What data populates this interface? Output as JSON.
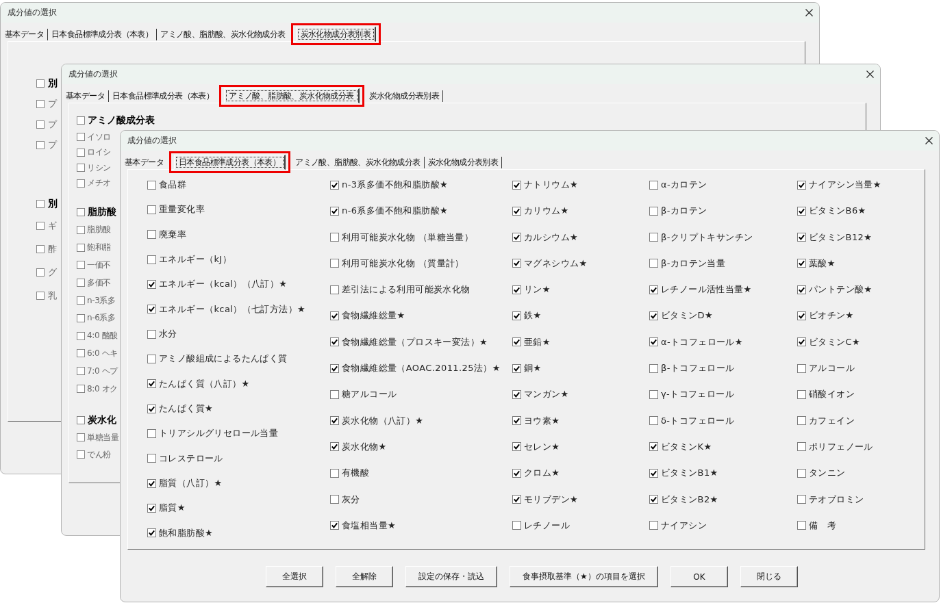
{
  "windows": [
    {
      "title": "成分値の選択",
      "tabs": [
        {
          "label": "基本データ",
          "selected": false,
          "highlighted": false
        },
        {
          "label": "日本食品標準成分表（本表）",
          "selected": false,
          "highlighted": false
        },
        {
          "label": "アミノ酸、脂肪酸、炭水化物成分表",
          "selected": false,
          "highlighted": false
        },
        {
          "label": "炭水化物成分表別表",
          "selected": true,
          "highlighted": true
        }
      ],
      "content": {
        "kind": "groups",
        "groups": [
          {
            "label": "別",
            "checked": false,
            "items": [
              {
                "label": "プ",
                "checked": false
              },
              {
                "label": "プ",
                "checked": false
              },
              {
                "label": "プ",
                "checked": false
              }
            ]
          },
          {
            "label": "別",
            "checked": false,
            "items": [
              {
                "label": "ギ",
                "checked": false
              },
              {
                "label": "酢",
                "checked": false
              },
              {
                "label": "グ",
                "checked": false
              },
              {
                "label": "乳",
                "checked": false
              }
            ]
          }
        ]
      }
    },
    {
      "title": "成分値の選択",
      "tabs": [
        {
          "label": "基本データ",
          "selected": false,
          "highlighted": false
        },
        {
          "label": "日本食品標準成分表（本表）",
          "selected": false,
          "highlighted": false
        },
        {
          "label": "アミノ酸、脂肪酸、炭水化物成分表",
          "selected": true,
          "highlighted": true
        },
        {
          "label": "炭水化物成分表別表",
          "selected": false,
          "highlighted": false
        }
      ],
      "content": {
        "kind": "groups",
        "groups": [
          {
            "label": "アミノ酸成分表",
            "checked": false,
            "items": [
              {
                "label": "イソロ",
                "checked": false
              },
              {
                "label": "ロイシ",
                "checked": false
              },
              {
                "label": "リシン",
                "checked": false
              },
              {
                "label": "メチオ",
                "checked": false
              }
            ]
          },
          {
            "label": "脂肪酸",
            "checked": false,
            "items": [
              {
                "label": "脂肪酸",
                "checked": false
              },
              {
                "label": "飽和脂",
                "checked": false
              },
              {
                "label": "一価不",
                "checked": false
              },
              {
                "label": "多価不",
                "checked": false
              },
              {
                "label": "n-3系多",
                "checked": false
              },
              {
                "label": "n-6系多",
                "checked": false
              },
              {
                "label": "4:0 酪酸",
                "checked": false
              },
              {
                "label": "6:0 ヘキ",
                "checked": false
              },
              {
                "label": "7:0 ヘプ",
                "checked": false
              },
              {
                "label": "8:0 オク",
                "checked": false
              }
            ]
          },
          {
            "label": "炭水化",
            "checked": false,
            "items": [
              {
                "label": "単糖当量",
                "checked": false
              },
              {
                "label": "でん粉",
                "checked": false
              }
            ]
          }
        ]
      }
    },
    {
      "title": "成分値の選択",
      "tabs": [
        {
          "label": "基本データ",
          "selected": false,
          "highlighted": false
        },
        {
          "label": "日本食品標準成分表（本表）",
          "selected": true,
          "highlighted": true
        },
        {
          "label": "アミノ酸、脂肪酸、炭水化物成分表",
          "selected": false,
          "highlighted": false
        },
        {
          "label": "炭水化物成分表別表",
          "selected": false,
          "highlighted": false
        }
      ],
      "content": {
        "kind": "columns",
        "columns": [
          [
            {
              "label": "食品群",
              "checked": false
            },
            {
              "label": "重量変化率",
              "checked": false
            },
            {
              "label": "廃棄率",
              "checked": false
            },
            {
              "label": "エネルギー（kJ）",
              "checked": false
            },
            {
              "label": "エネルギー（kcal）（八訂）★",
              "checked": true
            },
            {
              "label": "エネルギー（kcal）（七訂方法）★",
              "checked": true
            },
            {
              "label": "水分",
              "checked": false
            },
            {
              "label": "アミノ酸組成によるたんぱく質",
              "checked": false
            },
            {
              "label": "たんぱく質（八訂）★",
              "checked": true
            },
            {
              "label": "たんぱく質★",
              "checked": true
            },
            {
              "label": "トリアシルグリセロール当量",
              "checked": false
            },
            {
              "label": "コレステロール",
              "checked": false
            },
            {
              "label": "脂質（八訂）★",
              "checked": true
            },
            {
              "label": "脂質★",
              "checked": true
            },
            {
              "label": "飽和脂肪酸★",
              "checked": true
            }
          ],
          [
            {
              "label": "n-3系多価不飽和脂肪酸★",
              "checked": true
            },
            {
              "label": "n-6系多価不飽和脂肪酸★",
              "checked": true
            },
            {
              "label": "利用可能炭水化物 （単糖当量）",
              "checked": false
            },
            {
              "label": "利用可能炭水化物 （質量計）",
              "checked": false
            },
            {
              "label": "差引法による利用可能炭水化物",
              "checked": false
            },
            {
              "label": "食物繊維総量★",
              "checked": true
            },
            {
              "label": "食物繊維総量（プロスキー変法）★",
              "checked": true
            },
            {
              "label": "食物繊維総量（AOAC.2011.25法）★",
              "checked": true
            },
            {
              "label": "糖アルコール",
              "checked": false
            },
            {
              "label": "炭水化物（八訂）★",
              "checked": true
            },
            {
              "label": "炭水化物★",
              "checked": true
            },
            {
              "label": "有機酸",
              "checked": false
            },
            {
              "label": "灰分",
              "checked": false
            },
            {
              "label": "食塩相当量★",
              "checked": true
            }
          ],
          [
            {
              "label": "ナトリウム★",
              "checked": true
            },
            {
              "label": "カリウム★",
              "checked": true
            },
            {
              "label": "カルシウム★",
              "checked": true
            },
            {
              "label": "マグネシウム★",
              "checked": true
            },
            {
              "label": "リン★",
              "checked": true
            },
            {
              "label": "鉄★",
              "checked": true
            },
            {
              "label": "亜鉛★",
              "checked": true
            },
            {
              "label": "銅★",
              "checked": true
            },
            {
              "label": "マンガン★",
              "checked": true
            },
            {
              "label": "ヨウ素★",
              "checked": true
            },
            {
              "label": "セレン★",
              "checked": true
            },
            {
              "label": "クロム★",
              "checked": true
            },
            {
              "label": "モリブデン★",
              "checked": true
            },
            {
              "label": "レチノール",
              "checked": false
            }
          ],
          [
            {
              "label": "α-カロテン",
              "checked": false
            },
            {
              "label": "β-カロテン",
              "checked": false
            },
            {
              "label": "β-クリプトキサンチン",
              "checked": false
            },
            {
              "label": "β-カロテン当量",
              "checked": false
            },
            {
              "label": "レチノール活性当量★",
              "checked": true
            },
            {
              "label": "ビタミンD★",
              "checked": true
            },
            {
              "label": "α-トコフェロール★",
              "checked": true
            },
            {
              "label": "β-トコフェロール",
              "checked": false
            },
            {
              "label": "γ-トコフェロール",
              "checked": false
            },
            {
              "label": "δ-トコフェロール",
              "checked": false
            },
            {
              "label": "ビタミンK★",
              "checked": true
            },
            {
              "label": "ビタミンB1★",
              "checked": true
            },
            {
              "label": "ビタミンB2★",
              "checked": true
            },
            {
              "label": "ナイアシン",
              "checked": false
            }
          ],
          [
            {
              "label": "ナイアシン当量★",
              "checked": true
            },
            {
              "label": "ビタミンB6★",
              "checked": true
            },
            {
              "label": "ビタミンB12★",
              "checked": true
            },
            {
              "label": "葉酸★",
              "checked": true
            },
            {
              "label": "パントテン酸★",
              "checked": true
            },
            {
              "label": "ビオチン★",
              "checked": true
            },
            {
              "label": "ビタミンC★",
              "checked": true
            },
            {
              "label": "アルコール",
              "checked": false
            },
            {
              "label": "硝酸イオン",
              "checked": false
            },
            {
              "label": "カフェイン",
              "checked": false
            },
            {
              "label": "ポリフェノール",
              "checked": false
            },
            {
              "label": "タンニン",
              "checked": false
            },
            {
              "label": "テオブロミン",
              "checked": false
            },
            {
              "label": "備　考",
              "checked": false
            }
          ]
        ]
      },
      "buttons": [
        "全選択",
        "全解除",
        "設定の保存・読込",
        "食事摂取基準（★）の項目を選択",
        "OK",
        "閉じる"
      ]
    }
  ]
}
